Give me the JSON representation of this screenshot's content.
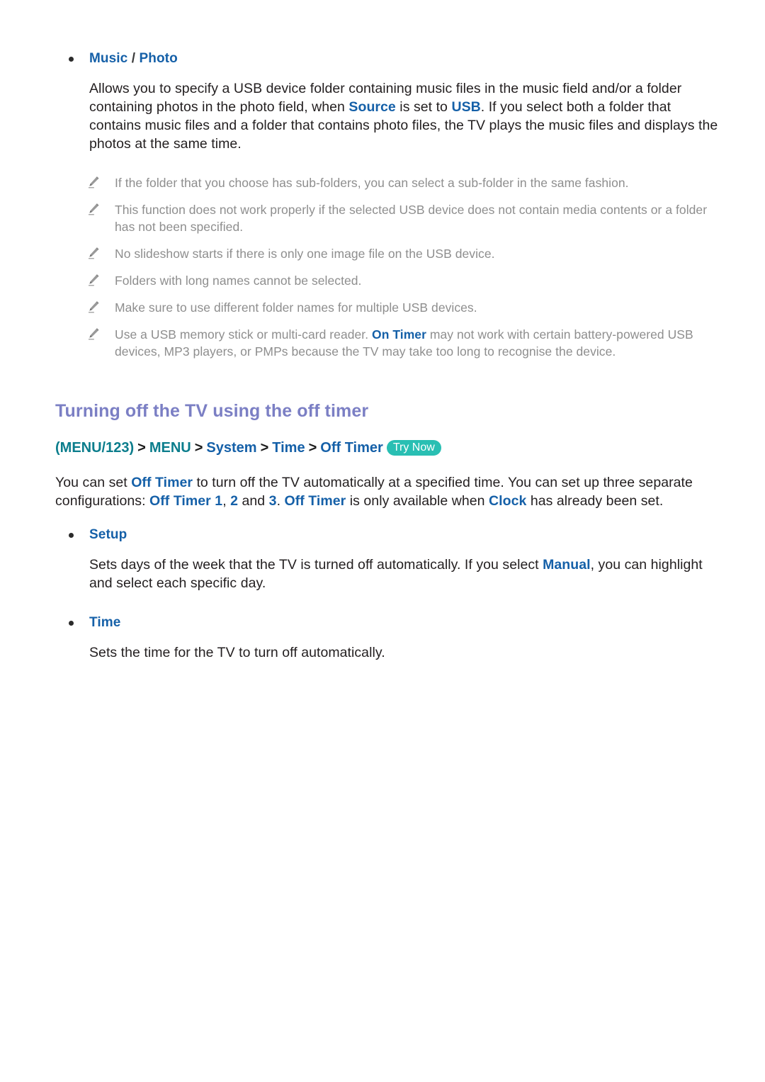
{
  "page": {
    "background_color": "#ffffff",
    "accent_blue": "#1560a8",
    "accent_teal": "#0b7d8c",
    "heading_color": "#7b7fc4",
    "note_gray": "#8e8e8e",
    "badge_color": "#29bfb3"
  },
  "music_photo_section": {
    "bullet_label_part1": "Music",
    "bullet_label_sep": " / ",
    "bullet_label_part2": "Photo",
    "paragraph": {
      "t1": "Allows you to specify a USB device folder containing music files in the music field and/or a folder containing photos in the photo field, when ",
      "link1": "Source",
      "t2": " is set to ",
      "link2": "USB",
      "t3": ". If you select both a folder that contains music files and a folder that contains photo files, the TV plays the music files and displays the photos at the same time."
    },
    "notes": [
      {
        "icon": "pencil-icon",
        "text": "If the folder that you choose has sub-folders, you can select a sub-folder in the same fashion."
      },
      {
        "icon": "pencil-icon",
        "text": "This function does not work properly if the selected USB device does not contain media contents or a folder has not been specified."
      },
      {
        "icon": "pencil-icon",
        "text": "No slideshow starts if there is only one image file on the USB device."
      },
      {
        "icon": "pencil-icon",
        "text": "Folders with long names cannot be selected."
      },
      {
        "icon": "pencil-icon",
        "text": "Make sure to use different folder names for multiple USB devices."
      }
    ],
    "note_last": {
      "icon": "pencil-icon",
      "t1": "Use a USB memory stick or multi-card reader. ",
      "link1": "On Timer",
      "t2": " may not work with certain battery-powered USB devices, MP3 players, or PMPs because the TV may take too long to recognise the device."
    }
  },
  "off_timer_section": {
    "heading": "Turning off the TV using the off timer",
    "menu_path": {
      "item1": "(MENU/123)",
      "arrow": ">",
      "item2": "MENU",
      "item3": "System",
      "item4": "Time",
      "item5": "Off Timer",
      "badge": "Try Now"
    },
    "intro": {
      "t1": "You can set ",
      "link1": "Off Timer",
      "t2": " to turn off the TV automatically at a specified time. You can set up three separate configurations: ",
      "link2": "Off Timer 1",
      "t3": ", ",
      "link3": "2",
      "t4": " and ",
      "link4": "3",
      "t5": ". ",
      "link5": "Off Timer",
      "t6": " is only available when ",
      "link6": "Clock",
      "t7": " has already been set."
    },
    "items": [
      {
        "label": "Setup",
        "desc_t1": "Sets days of the week that the TV is turned off automatically. If you select ",
        "desc_link": "Manual",
        "desc_t2": ", you can highlight and select each specific day."
      },
      {
        "label": "Time",
        "desc_t1": "Sets the time for the TV to turn off automatically.",
        "desc_link": "",
        "desc_t2": ""
      }
    ]
  }
}
